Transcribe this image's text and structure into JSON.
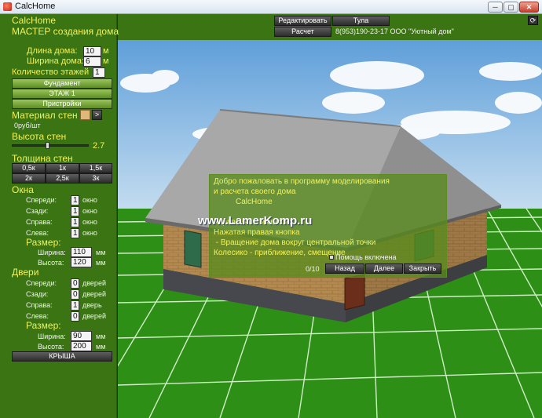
{
  "window": {
    "title": "CalcHome",
    "min": "─",
    "max": "▢",
    "close": "✕"
  },
  "panel": {
    "app_name": "CalcHome",
    "subtitle": "МАСТЕР создания дома",
    "length_label": "Длина дома:",
    "length_value": "10",
    "length_unit": "м",
    "width_label": "Ширина дома:",
    "width_value": "6",
    "width_unit": "м",
    "floors_label": "Количество этажей",
    "floors_value": "1",
    "foundation_button": "Фундамент",
    "floor_button": "ЭТАЖ 1",
    "extensions_button": "Пристройки",
    "wall_material_label": "Материал стен",
    "material_next": ">",
    "material_price": "0руб/шт",
    "wall_height_label": "Высота стен",
    "wall_height_value": "2.7",
    "wall_height_fraction": 0.46,
    "thickness_label": "Толщина стен",
    "thickness_buttons": [
      "0,5к",
      "1к",
      "1,5к",
      "2к",
      "2,5к",
      "3к"
    ],
    "windows_label": "Окна",
    "windows_rows": [
      {
        "label": "Спереди:",
        "value": "1",
        "unit": "окно"
      },
      {
        "label": "Сзади:",
        "value": "1",
        "unit": "окно"
      },
      {
        "label": "Справа:",
        "value": "1",
        "unit": "окно"
      },
      {
        "label": "Слева:",
        "value": "1",
        "unit": "окно"
      }
    ],
    "size_label": "Размер:",
    "win_width_label": "Ширина:",
    "win_width_value": "110",
    "win_width_unit": "мм",
    "win_height_label": "Высота:",
    "win_height_value": "120",
    "win_height_unit": "мм",
    "doors_label": "Двери",
    "doors_rows": [
      {
        "label": "Спереди:",
        "value": "0",
        "unit": "дверей"
      },
      {
        "label": "Сзади:",
        "value": "0",
        "unit": "дверей"
      },
      {
        "label": "Справа:",
        "value": "1",
        "unit": "дверь"
      },
      {
        "label": "Слева:",
        "value": "0",
        "unit": "дверей"
      }
    ],
    "door_size_label": "Размер:",
    "door_width_label": "Ширина:",
    "door_width_value": "90",
    "door_width_unit": "мм",
    "door_height_label": "Высота:",
    "door_height_value": "200",
    "door_height_unit": "мм",
    "roof_button": "КРЫША"
  },
  "top": {
    "edit_button": "Редактировать",
    "city_button": "Тула",
    "calc_button": "Расчет",
    "contact": "8(953)190-23-17 ООО \"Уютный дом\"",
    "refresh": "⟳"
  },
  "dialog": {
    "line1": "Добро пожаловать в программу моделирования",
    "line2": "и расчета своего дома",
    "line3": "CalcHome",
    "line4": "Управление мышкой:",
    "line5": "Нажатая правая кнопка",
    "line6": " - Вращение дома вокруг центральной точки",
    "line7": "Колесико - приближение, смещение",
    "help_label": "Помощь включена",
    "counter": "0/10",
    "back_button": "Назад",
    "next_button": "Далее",
    "close_button": "Закрыть"
  },
  "watermark": "www.LamerKomp.ru",
  "colors": {
    "panel": "#3b7412",
    "text": "#f2f25a",
    "grass": "#2e8a14",
    "sky": "#7eb2e0",
    "roof": "#a6a6a6",
    "brick": "#b0884e"
  }
}
